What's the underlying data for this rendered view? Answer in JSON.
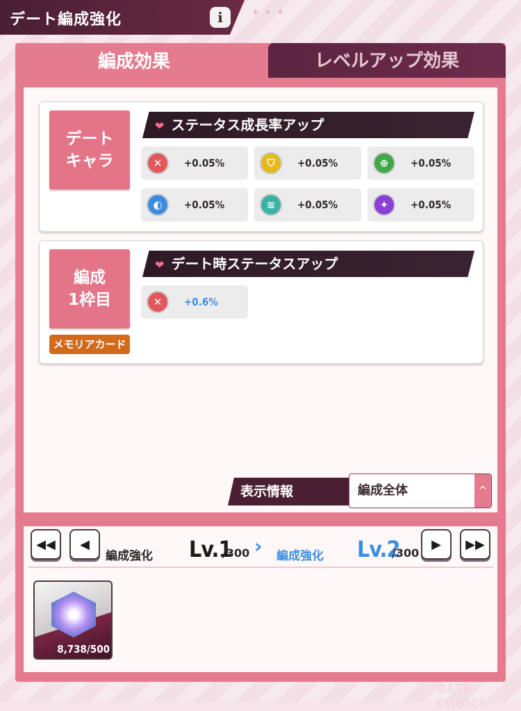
{
  "header": {
    "title": "デート編成強化",
    "info_icon": "i"
  },
  "tabs": [
    {
      "label": "編成効果",
      "active": true
    },
    {
      "label": "レベルアップ効果",
      "active": false
    }
  ],
  "cards": [
    {
      "target_line1": "デート",
      "target_line2": "キャラ",
      "section_title": "ステータス成長率アップ",
      "stats": [
        {
          "icon": "attack-sword-icon",
          "color": "#e2575c",
          "value": "+0.05%"
        },
        {
          "icon": "defense-shield-icon",
          "color": "#e6b81a",
          "value": "+0.05%"
        },
        {
          "icon": "accuracy-target-icon",
          "color": "#41a84a",
          "value": "+0.05%"
        },
        {
          "icon": "evasion-moon-icon",
          "color": "#3c8de0",
          "value": "+0.05%"
        },
        {
          "icon": "speed-wing-icon",
          "color": "#39b3a5",
          "value": "+0.05%"
        },
        {
          "icon": "critical-sparkle-icon",
          "color": "#8a3fd6",
          "value": "+0.05%"
        }
      ]
    },
    {
      "target_line1": "編成",
      "target_line2": "1枠目",
      "badge": "メモリアカード",
      "section_title": "デート時ステータスアップ",
      "stats": [
        {
          "icon": "attack-sword-icon",
          "color": "#e2575c",
          "value": "+0.6%"
        }
      ]
    }
  ],
  "display_info": {
    "label": "表示情報",
    "selected": "編成全体"
  },
  "level": {
    "current_label": "編成強化",
    "current_level": "Lv.1",
    "current_max": "/300",
    "next_label": "編成強化",
    "next_level": "Lv.2",
    "next_max": "/300"
  },
  "item": {
    "icon": "crystal-cube-icon",
    "count": "8,738/500"
  },
  "watermark": "DATE CHOICE",
  "colors": {
    "accent": "#e57b8e",
    "dark": "#4a1f33",
    "highlight": "#3b8fe3"
  }
}
